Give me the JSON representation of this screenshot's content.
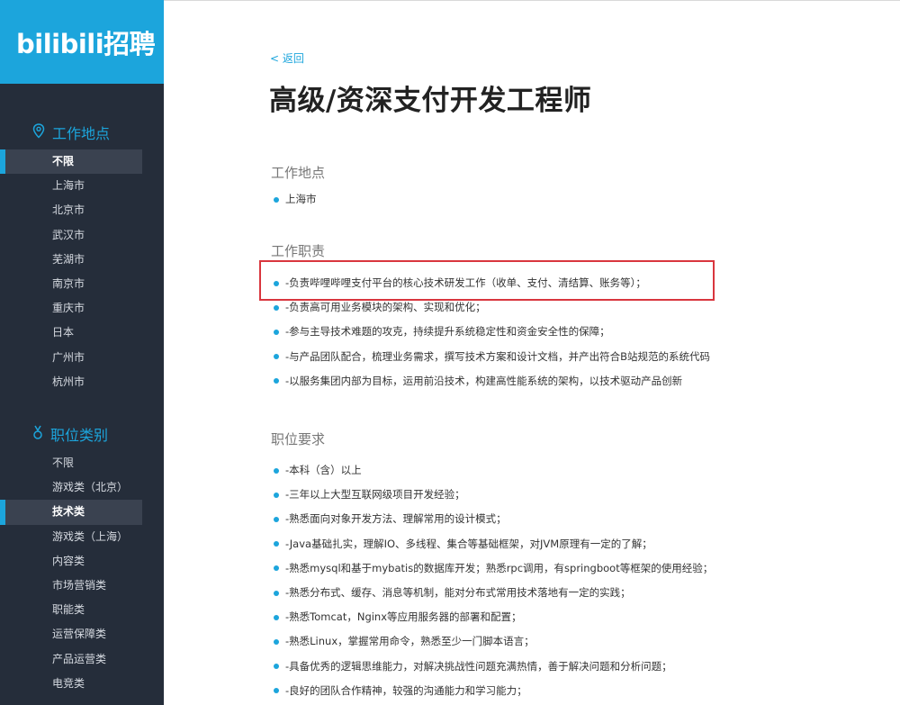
{
  "logo": "bilibili招聘",
  "sidebar": {
    "location_title": "工作地点",
    "locations": [
      {
        "label": "不限",
        "active": true
      },
      {
        "label": "上海市",
        "active": false
      },
      {
        "label": "北京市",
        "active": false
      },
      {
        "label": "武汉市",
        "active": false
      },
      {
        "label": "芜湖市",
        "active": false
      },
      {
        "label": "南京市",
        "active": false
      },
      {
        "label": "重庆市",
        "active": false
      },
      {
        "label": "日本",
        "active": false
      },
      {
        "label": "广州市",
        "active": false
      },
      {
        "label": "杭州市",
        "active": false
      }
    ],
    "category_title": "职位类别",
    "categories": [
      {
        "label": "不限",
        "active": false
      },
      {
        "label": "游戏类（北京）",
        "active": false
      },
      {
        "label": "技术类",
        "active": true
      },
      {
        "label": "游戏类（上海）",
        "active": false
      },
      {
        "label": "内容类",
        "active": false
      },
      {
        "label": "市场营销类",
        "active": false
      },
      {
        "label": "职能类",
        "active": false
      },
      {
        "label": "运营保障类",
        "active": false
      },
      {
        "label": "产品运营类",
        "active": false
      },
      {
        "label": "电竞类",
        "active": false
      }
    ]
  },
  "main": {
    "back": "< 返回",
    "title": "高级/资深支付开发工程师",
    "location_heading": "工作地点",
    "location_items": [
      "上海市"
    ],
    "duty_heading": "工作职责",
    "duties": [
      "-负责哔哩哔哩支付平台的核心技术研发工作（收单、支付、清结算、账务等）；",
      "-负责高可用业务模块的架构、实现和优化；",
      "-参与主导技术难题的攻克，持续提升系统稳定性和资金安全性的保障；",
      "-与产品团队配合，梳理业务需求，撰写技术方案和设计文档，并产出符合B站规范的系统代码",
      "-以服务集团内部为目标，运用前沿技术，构建高性能系统的架构，以技术驱动产品创新"
    ],
    "req_heading": "职位要求",
    "requirements": [
      "-本科（含）以上",
      "-三年以上大型互联网级项目开发经验；",
      "-熟悉面向对象开发方法、理解常用的设计模式；",
      "-Java基础扎实，理解IO、多线程、集合等基础框架，对JVM原理有一定的了解；",
      "-熟悉mysql和基于mybatis的数据库开发；熟悉rpc调用，有springboot等框架的使用经验；",
      "-熟悉分布式、缓存、消息等机制，能对分布式常用技术落地有一定的实践；",
      "-熟悉Tomcat，Nginx等应用服务器的部署和配置；",
      "-熟悉Linux，掌握常用命令，熟悉至少一门脚本语言；",
      "-具备优秀的逻辑思维能力，对解决挑战性问题充满热情，善于解决问题和分析问题；",
      "-良好的团队合作精神，较强的沟通能力和学习能力；"
    ]
  },
  "colors": {
    "accent": "#1ca5dc",
    "sidebar_bg": "#252d3a",
    "highlight": "#d9363e"
  }
}
